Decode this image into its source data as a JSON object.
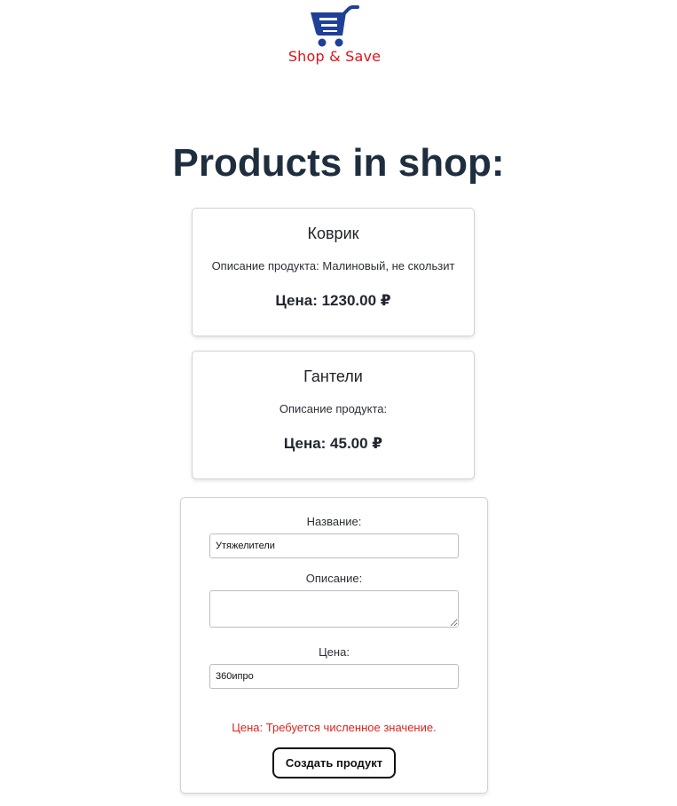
{
  "logo": {
    "text": "Shop & Save",
    "icon": "shopping-cart-icon",
    "cart_color": "#1f3f99",
    "text_color": "#e0111a"
  },
  "title": "Products in shop:",
  "products": [
    {
      "name": "Коврик",
      "description": "Описание продукта: Малиновый, не скользит",
      "price": "Цена: 1230.00 ₽"
    },
    {
      "name": "Гантели",
      "description": "Описание продукта:",
      "price": "Цена: 45.00 ₽"
    }
  ],
  "form": {
    "name_label": "Название:",
    "name_value": "Утяжелители",
    "description_label": "Описание:",
    "description_value": "",
    "price_label": "Цена:",
    "price_value": "360ипро",
    "error": "Цена: Требуется численное значение.",
    "submit_label": "Создать продукт",
    "error_color": "#e0231d"
  }
}
